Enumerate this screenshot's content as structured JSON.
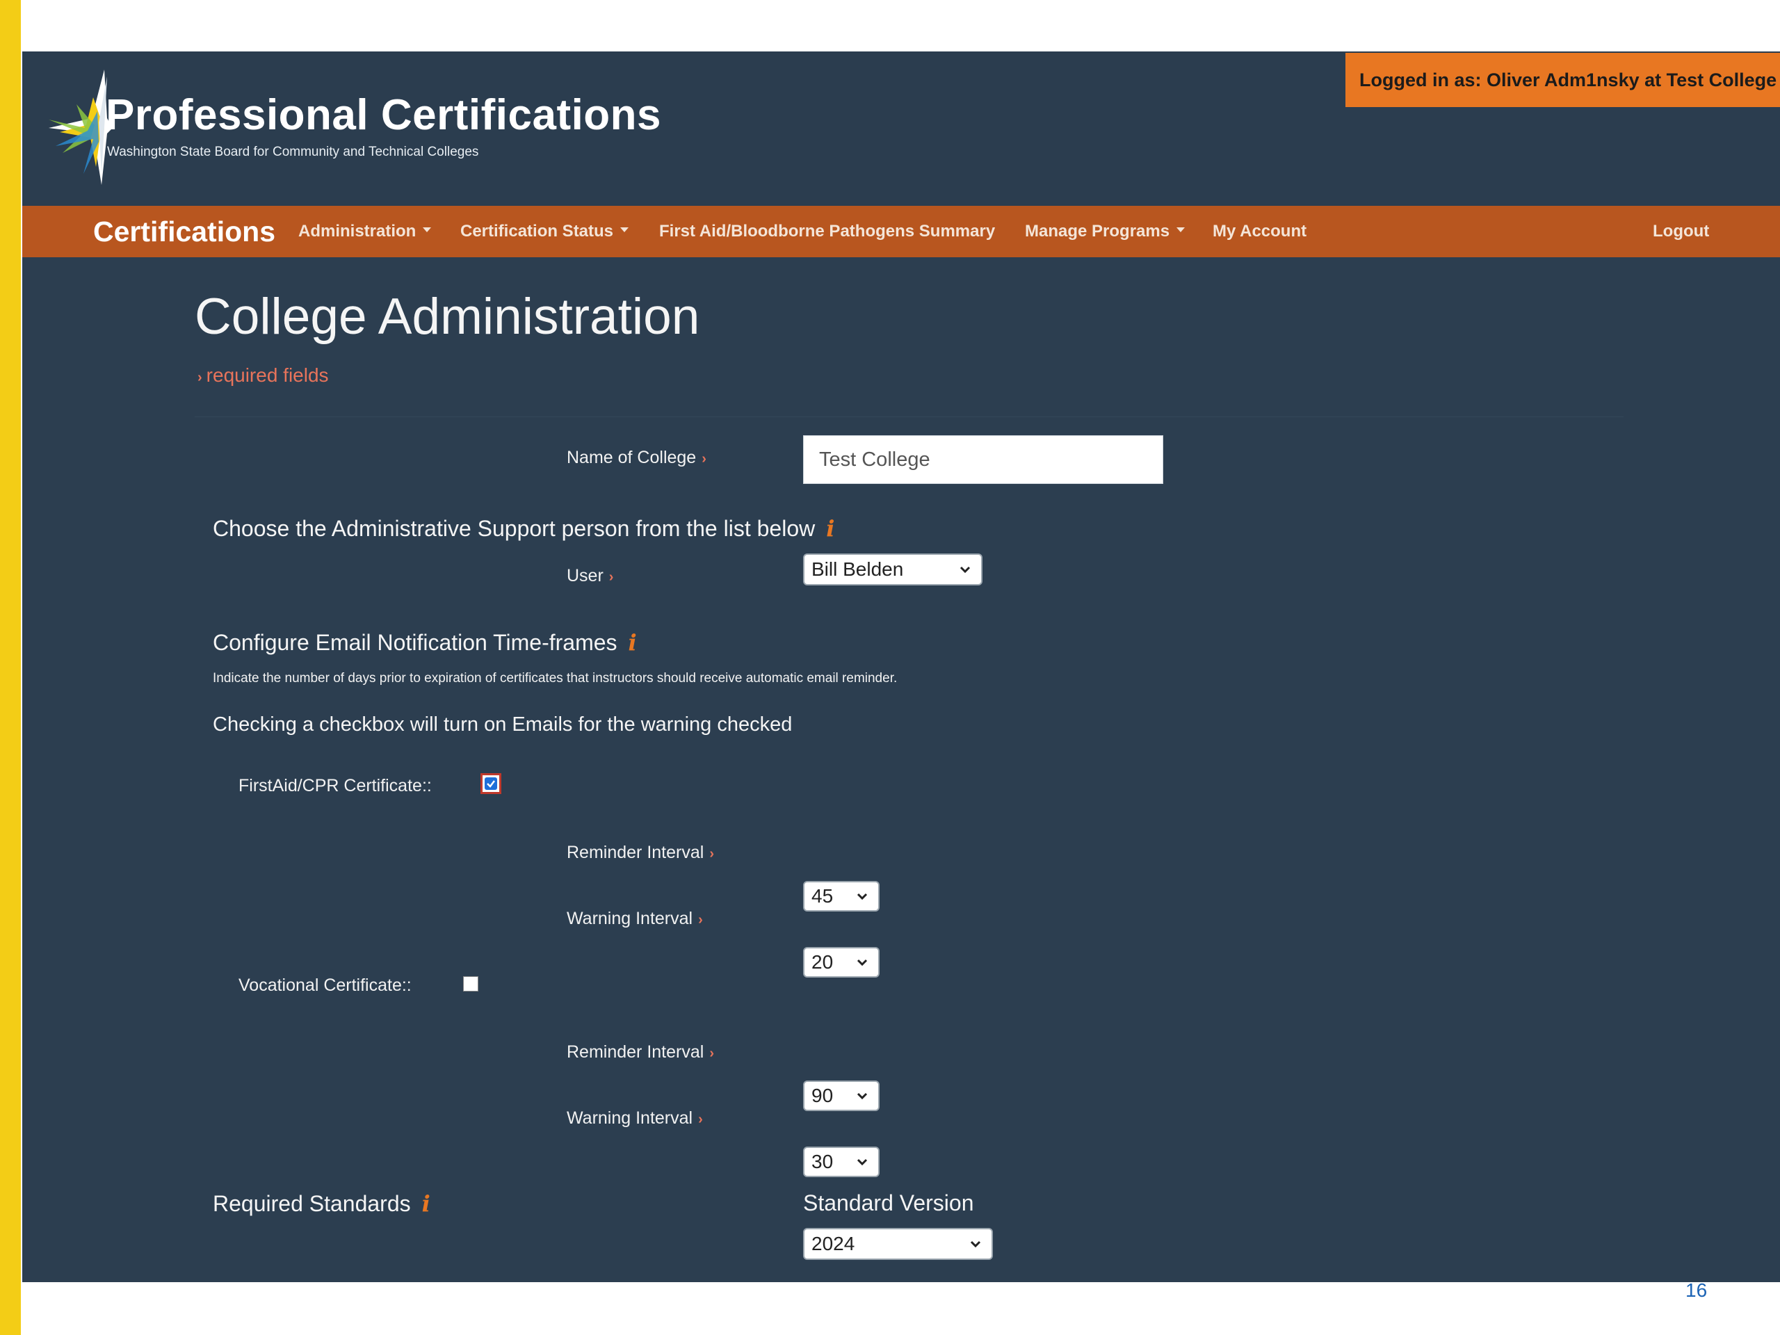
{
  "header": {
    "brand_title": "Professional Certifications",
    "brand_subtitle": "Washington State Board for Community and Technical Colleges",
    "login_text": "Logged in as: Oliver Adm1nsky at Test College"
  },
  "nav": {
    "brand": "Certifications",
    "items": [
      {
        "label": "Administration",
        "dropdown": true
      },
      {
        "label": "Certification Status",
        "dropdown": true
      },
      {
        "label": "First Aid/Bloodborne Pathogens Summary",
        "dropdown": false
      },
      {
        "label": "Manage Programs",
        "dropdown": true
      },
      {
        "label": "My Account",
        "dropdown": false
      }
    ],
    "logout": "Logout"
  },
  "page": {
    "title": "College Administration",
    "required_note": "required fields"
  },
  "form": {
    "college_name_label": "Name of College",
    "college_name_value": "Test College",
    "admin_support_heading": "Choose the Administrative Support person from the list below",
    "user_label": "User",
    "user_value": "Bill Belden",
    "email_heading": "Configure Email Notification Time-frames",
    "email_helper": "Indicate the number of days prior to expiration of certificates that instructors should receive automatic email reminder.",
    "checkbox_note": "Checking a checkbox will turn on Emails for the warning checked",
    "firstaid": {
      "label": "FirstAid/CPR Certificate::",
      "checked": true,
      "reminder_label": "Reminder Interval",
      "reminder_value": "45",
      "warning_label": "Warning Interval",
      "warning_value": "20"
    },
    "vocational": {
      "label": "Vocational Certificate::",
      "checked": false,
      "reminder_label": "Reminder Interval",
      "reminder_value": "90",
      "warning_label": "Warning Interval",
      "warning_value": "30"
    },
    "standards_heading": "Required Standards",
    "standard_version_label": "Standard Version",
    "standard_version_value": "2024"
  },
  "slide_number": "16",
  "colors": {
    "app_background": "#2c3e50",
    "navbar": "#b8561f",
    "login_badge": "#e87722",
    "required_marker": "#e8745b",
    "side_bar": "#f3cd16"
  }
}
